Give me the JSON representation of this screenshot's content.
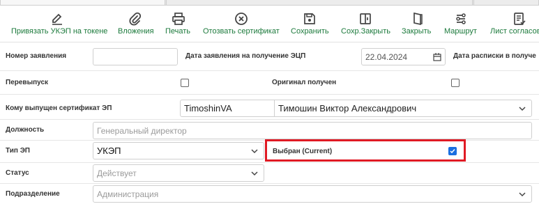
{
  "toolbar": {
    "bind_ukep_label": "Привязать УКЭП на токене",
    "attachments_label": "Вложения",
    "print_label": "Печать",
    "revoke_label": "Отозвать сертификат",
    "save_label": "Сохранить",
    "save_close_label": "Сохр.Закрыть",
    "close_label": "Закрыть",
    "route_label": "Маршрут",
    "approval_sheet_label": "Лист согласова"
  },
  "form": {
    "application_number": {
      "label": "Номер заявления",
      "value": ""
    },
    "application_date": {
      "label": "Дата заявления на получение ЭЦП",
      "value": "22.04.2024"
    },
    "receipt_date": {
      "label": "Дата расписки в получе"
    },
    "reissue": {
      "label": "Перевыпуск",
      "checked": false
    },
    "original_received": {
      "label": "Оригинал получен",
      "checked": false
    },
    "issued_to": {
      "label": "Кому выпущен сертификат ЭП",
      "login": "TimoshinVA",
      "full_name": "Тимошин Виктор Александрович"
    },
    "position": {
      "label": "Должность",
      "value": "Генеральный директор"
    },
    "ep_type": {
      "label": "Тип ЭП",
      "value": "УКЭП"
    },
    "selected_current": {
      "label": "Выбран (Current)",
      "checked": true
    },
    "status": {
      "label": "Статус",
      "value": "Действует"
    },
    "department": {
      "label": "Подразделение",
      "value": "Администрация"
    }
  },
  "colors": {
    "toolbar_label": "#1c7a3c",
    "highlight": "#e01a24",
    "checkbox": "#1a6fe0"
  }
}
